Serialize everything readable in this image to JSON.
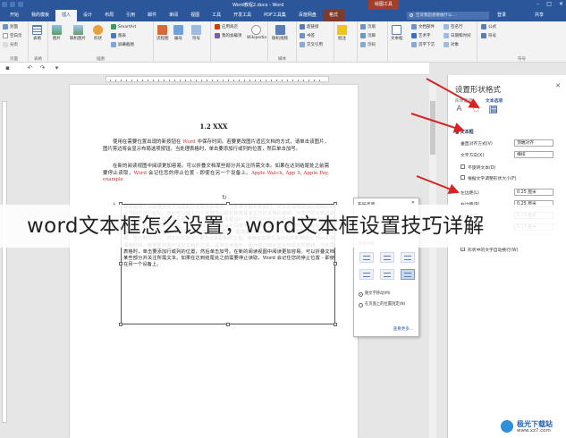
{
  "window": {
    "title": "Word教程2.docx - Word",
    "context_tool": "绘图工具"
  },
  "tabs": [
    "开始",
    "我的模板",
    "插入",
    "设计",
    "布局",
    "引用",
    "邮件",
    "审阅",
    "视图",
    "工具",
    "开发工具",
    "PDF工具集",
    "百度网盘",
    "格式"
  ],
  "active_tab": "插入",
  "search_placeholder": "告诉我您想要做什么...",
  "signin_label": "登录",
  "share_label": "共享",
  "ribbon": {
    "groups": [
      "页面",
      "表格",
      "插图",
      "媒体",
      "符号"
    ],
    "buttons": {
      "cover": "封面",
      "blank_page": "空白页",
      "page_break": "分页",
      "table": "表格",
      "picture": "图片",
      "online_picture": "联机图片",
      "shape": "形状",
      "smartart": "SmartArt",
      "chart": "图表",
      "screenshot": "屏幕截图",
      "flowchart": "流程图",
      "store": "应用商店",
      "my_addins": "我的加载项",
      "wikipedia": "Wikipedia",
      "online_video": "联机视频",
      "link": "超链接",
      "bookmark": "书签",
      "crossref": "交叉引用",
      "comment": "批注",
      "header": "页眉",
      "footer": "页脚",
      "page_number": "页码",
      "textbox": "文本框",
      "quickparts": "文档部件",
      "wordart": "艺术字",
      "dropcap": "首字下沉",
      "signature": "签名行",
      "datetime": "日期和时间",
      "object": "对象",
      "equation": "公式",
      "symbol": "符号",
      "number": "编号"
    }
  },
  "document": {
    "heading": "1.2 XXX",
    "para1_a": "使用在需要位置出现的新按钮在",
    "para1_word": "Word",
    "para1_b": "中保存时间。若要更改图片适应文档的方式，请单击该图片，图片旁边将会显示布局选项按钮。当处理表格时，单击要添加行或列的位置，然后单击加号。",
    "para2_a": "在新的阅读视图中阅读更加容易。可以折叠文档某些部分并关注所需文本。如果在达到结尾处之前需要停止读取，",
    "para2_word": "Word",
    "para2_b": "会记住您的停止位置 - 即使在另一个设备上。",
    "para2_links": [
      "Apple Watch",
      "App 9",
      "Apple Pay",
      "example"
    ],
    "frame_text": "视频提供了功能强大的方法帮助您证明您的观点。当您单击联机视频时，可以在想要添加的视频的嵌入代码中进行粘贴。您也可以键入一个关键字以联机搜索最适合您的文档的视频。为使您的文档具有专业外观，Word 提供了页眉、页脚、封面和文本框设计，这些设计可互为补充。例如，您可以添加匹配的封面、页眉和提要栏。单击“插入”，然后从不同库中选择所需元素。主题和样式也有助于文档保持协调。当您单击设计并选择新的主题时，图片、图表或 SmartArt 图形将会更改以匹配新的主题。当应用样式时，您的标题会进行更改以匹配新的主题。使用在需要位置出现的新按钮在 Word 中保存时间。若要更改图片适应文档的方式，请单击该图片，图片旁边将会显示布局选项按钮。当处理表格时，单击要添加行或列的位置，然后单击加号。在新的阅读视图中阅读更加容易。可以折叠文档某些部分并关注所需文本。如果在达到结尾处之前需要停止读取，Word 会记住您的停止位置 - 即使在另一个设备上。"
  },
  "layout_popup": {
    "title": "布局选项",
    "section_wrap": "文字环绕",
    "radio_move": "随文字移动(M)",
    "radio_fixed": "在页面上的位置固定(N)",
    "see_more": "查看更多..."
  },
  "format_pane": {
    "title": "设置形状格式",
    "tab_shape": "形状选项",
    "tab_text": "文本选项",
    "section": "文本框",
    "rows": [
      {
        "label": "垂直对齐方式(V)",
        "value": "顶端对齐"
      },
      {
        "label": "文字方向(X)",
        "value": "横排"
      }
    ],
    "checks": [
      {
        "label": "不旋转文本(D)",
        "checked": false
      },
      {
        "label": "根据文字调整形状大小(F)",
        "checked": false
      }
    ],
    "margins": [
      {
        "label": "左边距(L)",
        "value": "0.25 厘米"
      },
      {
        "label": "右边距(R)",
        "value": "0.25 厘米"
      },
      {
        "label": "上边距(T)",
        "value": "0.13 厘米"
      },
      {
        "label": "下边距(B)",
        "value": "0.13 厘米"
      }
    ],
    "wrap_check": {
      "label": "形状中的文字自动换行(W)",
      "checked": true
    }
  },
  "overlay_title": "word文本框怎么设置，word文本框设置技巧详解",
  "watermark": {
    "name": "极光下载站",
    "url": "www.xz7.com"
  },
  "colors": {
    "brand": "#2b579a",
    "arrow": "#d42424",
    "context_tab": "#a33e2a"
  }
}
